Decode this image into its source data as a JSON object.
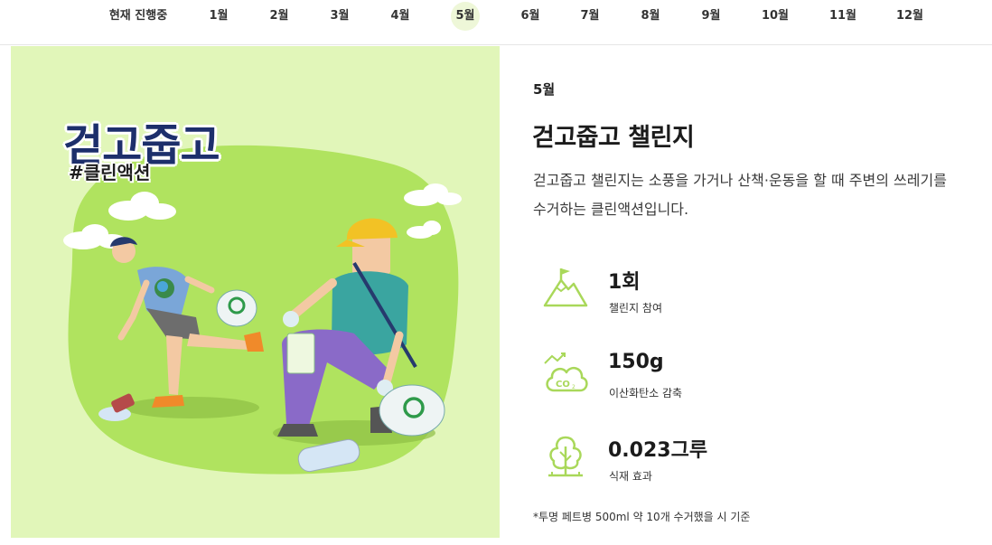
{
  "tabs": [
    "현재 진행중",
    "1월",
    "2월",
    "3월",
    "4월",
    "5월",
    "6월",
    "7월",
    "8월",
    "9월",
    "10월",
    "11월",
    "12월"
  ],
  "active_tab": "5월",
  "hero": {
    "title": "걷고줍고",
    "tag": "#클린액션"
  },
  "detail": {
    "month": "5월",
    "title": "걷고줍고 챌린지",
    "description_line1": "걷고줍고 챌린지는 소풍을 가거나 산책·운동을 할 때 주변의 쓰레기를",
    "description_line2": "수거하는 클린액션입니다."
  },
  "stats": [
    {
      "icon": "mountain-flag-icon",
      "value": "1회",
      "label": "챌린지 참여"
    },
    {
      "icon": "co2-cloud-icon",
      "value": "150g",
      "label": "이산화탄소 감축"
    },
    {
      "icon": "tree-icon",
      "value": "0.023그루",
      "label": "식재 효과"
    }
  ],
  "footnote": "*투명 페트병 500ml 약 10개 수거했을 시 기준",
  "colors": {
    "accent_green": "#a9d85a",
    "hero_bg": "#e1f6b9",
    "tab_active_bg": "#eef7d8"
  }
}
